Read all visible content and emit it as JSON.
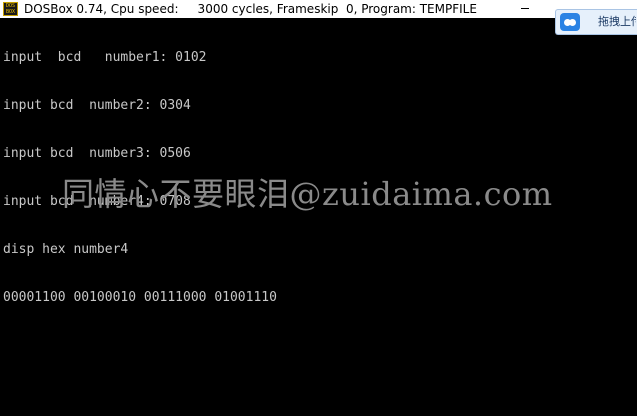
{
  "window": {
    "title": "DOSBox 0.74, Cpu speed:     3000 cycles, Frameskip  0, Program: TEMPFILE",
    "icon": "dosbox-icon",
    "icon_text": "DOS BOX"
  },
  "overlay": {
    "cloud_label": "拖拽上传",
    "cloud_icon": "cloud-icon",
    "cloud_color": "#2b83e4"
  },
  "console": {
    "lines": [
      "input  bcd   number1: 0102",
      "input bcd  number2: 0304",
      "input bcd  number3: 0506",
      "input bcd  number4: 0708",
      "disp hex number4",
      "00001100 00100010 00111000 01001110"
    ]
  },
  "watermark": {
    "text": "同情心不要眼泪@zuidaima.com"
  },
  "colors": {
    "background": "#000000",
    "console_text": "#c8c8c8",
    "watermark_text": "#8a8a8a",
    "titlebar": "#ffffff"
  }
}
